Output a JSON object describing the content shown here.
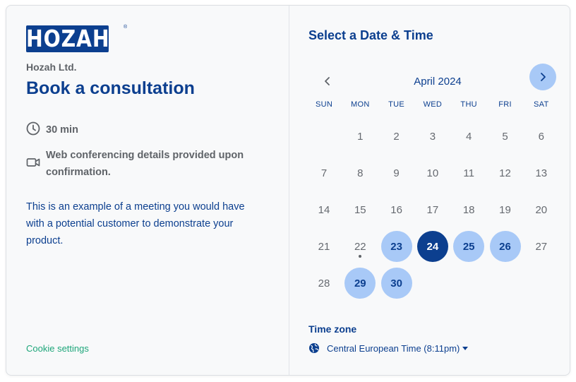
{
  "brand": {
    "logo_text": "HOZAH",
    "registered_mark": "®",
    "company": "Hozah Ltd.",
    "primary_color": "#0c3f8f",
    "accent_color": "#a8c9f7",
    "link_color": "#1ea67a"
  },
  "event": {
    "title": "Book a consultation",
    "duration": "30 min",
    "duration_icon": "clock-icon",
    "location_line1": "Web conferencing details provided upon",
    "location_line2": "confirmation.",
    "location_icon": "video-camera-icon",
    "desc_line1": "This is an example of a meeting you would have",
    "desc_line2": "with a potential customer to demonstrate your",
    "desc_line3": "product."
  },
  "footer": {
    "cookie_settings": "Cookie settings"
  },
  "scheduler": {
    "heading": "Select a Date & Time",
    "month": "April 2024",
    "prev_icon": "chevron-left-icon",
    "next_icon": "chevron-right-icon",
    "weekdays": [
      "SUN",
      "MON",
      "TUE",
      "WED",
      "THU",
      "FRI",
      "SAT"
    ],
    "weeks": [
      [
        "",
        "1",
        "2",
        "3",
        "4",
        "5",
        "6"
      ],
      [
        "7",
        "8",
        "9",
        "10",
        "11",
        "12",
        "13"
      ],
      [
        "14",
        "15",
        "16",
        "17",
        "18",
        "19",
        "20"
      ],
      [
        "21",
        "22",
        "23",
        "24",
        "25",
        "26",
        "27"
      ],
      [
        "28",
        "29",
        "30",
        "",
        "",
        "",
        ""
      ]
    ],
    "available_days": [
      "23",
      "24",
      "25",
      "26",
      "29",
      "30"
    ],
    "selected_day": "24",
    "today": "22",
    "timezone_label": "Time zone",
    "timezone_icon": "globe-icon",
    "timezone_value": "Central European Time (8:11pm)"
  }
}
